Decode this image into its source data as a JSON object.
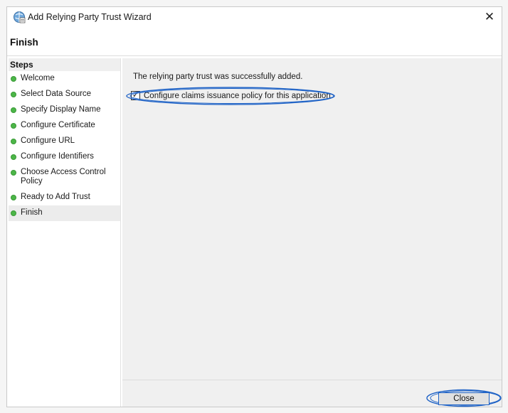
{
  "window": {
    "title": "Add Relying Party Trust Wizard",
    "close_glyph": "✕",
    "page_title": "Finish"
  },
  "steps": {
    "heading": "Steps",
    "items": [
      {
        "label": "Welcome"
      },
      {
        "label": "Select Data Source"
      },
      {
        "label": "Specify Display Name"
      },
      {
        "label": "Configure Certificate"
      },
      {
        "label": "Configure URL"
      },
      {
        "label": "Configure Identifiers"
      },
      {
        "label": "Choose Access Control Policy"
      },
      {
        "label": "Ready to Add Trust"
      },
      {
        "label": "Finish"
      }
    ],
    "status_color": "#4cb648"
  },
  "content": {
    "message": "The relying party trust was successfully added.",
    "checkbox_label": "Configure claims issuance policy for this application",
    "checkbox_checked": true,
    "check_glyph": "✓"
  },
  "footer": {
    "close_label": "Close"
  },
  "highlight_color": "#1e62c6"
}
